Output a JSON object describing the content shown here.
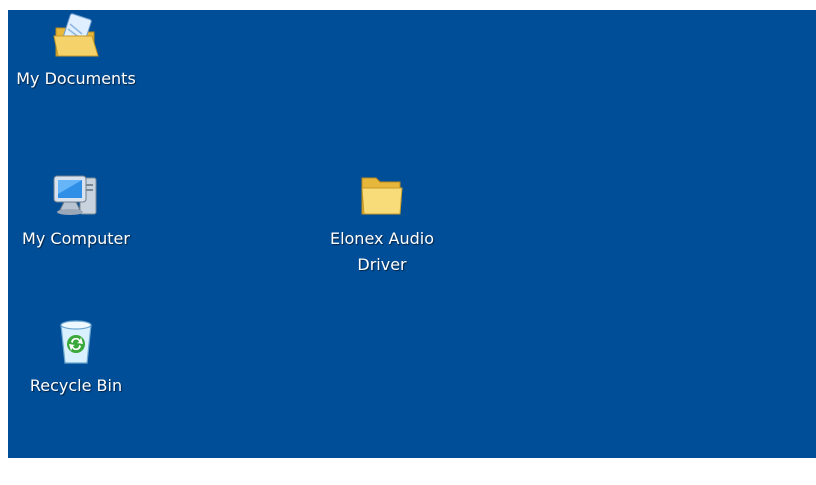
{
  "desktop": {
    "background_color": "#004e98",
    "icons": [
      {
        "label": "My Documents",
        "icon": "my-documents-folder-icon"
      },
      {
        "label": "My Computer",
        "icon": "my-computer-icon"
      },
      {
        "label": "Recycle Bin",
        "icon": "recycle-bin-icon"
      },
      {
        "label": "Elonex Audio\nDriver",
        "icon": "folder-icon"
      }
    ]
  }
}
